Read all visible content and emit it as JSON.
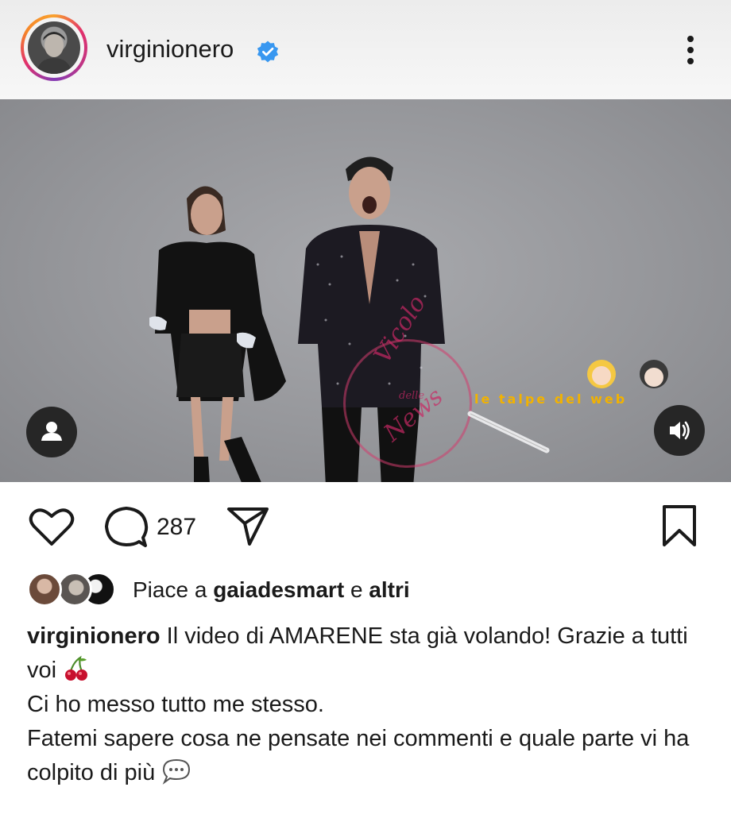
{
  "post": {
    "username": "virginionero",
    "verified": true,
    "comments_count": "287",
    "likes": {
      "prefix": "Piace a",
      "user": "gaiadesmart",
      "connector": "e",
      "others": "altri"
    },
    "caption": {
      "username": "virginionero",
      "line1": "Il video di AMARENE sta già volando! Grazie a tutti voi",
      "line2": "Ci ho messo tutto me stesso.",
      "line3": "Fatemi sapere cosa ne pensate nei commenti e quale parte vi ha colpito di più"
    }
  },
  "watermark": {
    "circle_text_1": "Vicolo",
    "circle_text_2": "delle",
    "circle_text_3": "News",
    "strip_text": "le talpe del web"
  },
  "icons": {
    "verified": "verified-badge-icon",
    "more": "more-vertical-icon",
    "like": "heart-icon",
    "comment": "comment-icon",
    "share": "send-icon",
    "save": "bookmark-icon",
    "user_tag": "person-icon",
    "volume": "volume-icon",
    "cherry": "cherries-emoji",
    "speech": "speech-bubble-emoji"
  },
  "colors": {
    "verified_blue": "#3897f0",
    "text": "#1a1a1a",
    "video_button_bg": "#262626"
  }
}
